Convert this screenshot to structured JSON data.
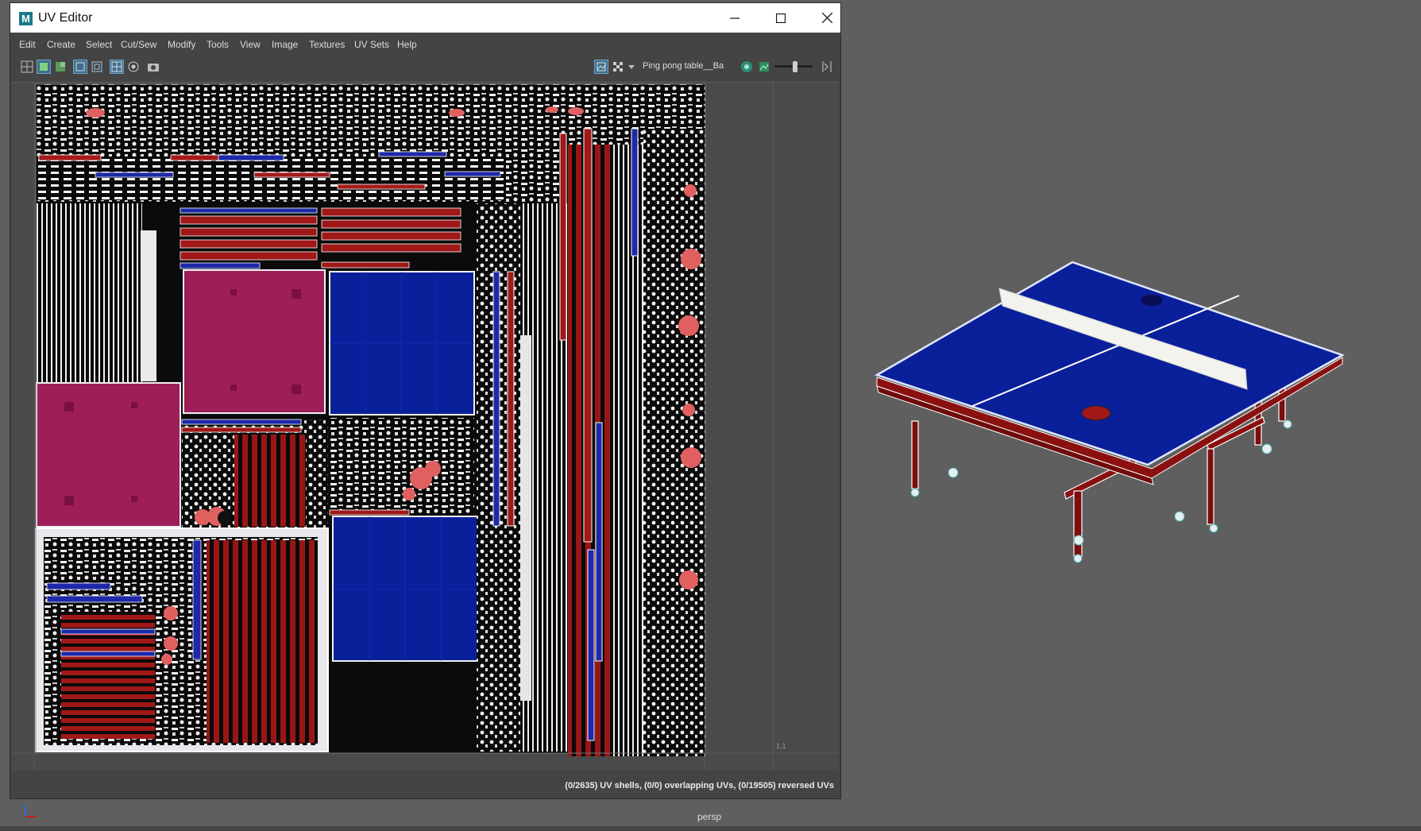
{
  "window": {
    "title": "UV Editor"
  },
  "menu": [
    "Edit",
    "Create",
    "Select",
    "Cut/Sew",
    "Modify",
    "Tools",
    "View",
    "Image",
    "Textures",
    "UV Sets",
    "Help"
  ],
  "toolbar": {
    "icons": [
      "grid-icon",
      "uv-shell-icon",
      "texture-icon",
      "frame-icon",
      "frame-all-icon",
      "checker-grid-icon",
      "snap-icon",
      "snapshot-icon"
    ],
    "texture_name": "Ping pong table__Ba",
    "image_toggle_icon": "image-display-icon",
    "checker_icon": "checker-icon",
    "exposure_level": 0.55
  },
  "uv_view": {
    "corner_label": "1,1"
  },
  "status": {
    "text": "(0/2635) UV shells, (0/0) overlapping UVs, (0/19505) reversed UVs"
  },
  "viewport": {
    "camera": "persp"
  },
  "colors": {
    "table_blue": "#0a1f9a",
    "frame_red": "#8b1010",
    "uv_red": "#a01818",
    "uv_blue": "#1a2aa8",
    "patch_pink": "#9e1e5a"
  }
}
